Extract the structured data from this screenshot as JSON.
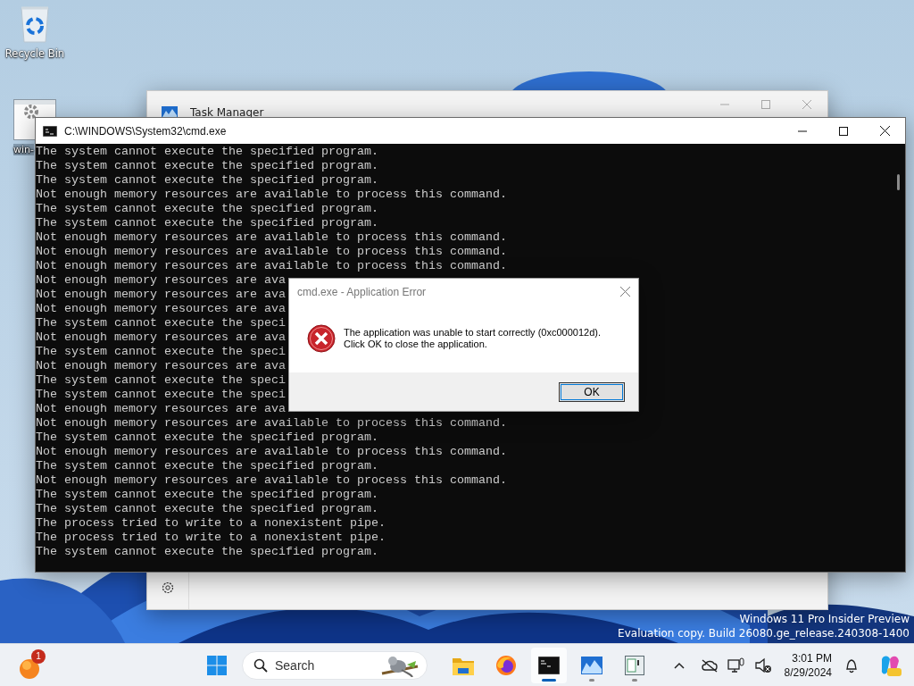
{
  "desktop_icons": [
    {
      "kind": "recycle",
      "label": "Recycle Bin"
    },
    {
      "kind": "settings",
      "label": "win-"
    }
  ],
  "task_manager": {
    "title": "Task Manager"
  },
  "console_window": {
    "title": "C:\\WINDOWS\\System32\\cmd.exe",
    "lines": [
      "The system cannot execute the specified program.",
      "The system cannot execute the specified program.",
      "The system cannot execute the specified program.",
      "Not enough memory resources are available to process this command.",
      "The system cannot execute the specified program.",
      "The system cannot execute the specified program.",
      "Not enough memory resources are available to process this command.",
      "Not enough memory resources are available to process this command.",
      "Not enough memory resources are available to process this command.",
      "Not enough memory resources are ava",
      "Not enough memory resources are ava",
      "Not enough memory resources are ava",
      "The system cannot execute the speci",
      "Not enough memory resources are ava",
      "The system cannot execute the speci",
      "Not enough memory resources are ava",
      "The system cannot execute the speci",
      "The system cannot execute the speci",
      "Not enough memory resources are ava",
      "Not enough memory resources are available to process this command.",
      "The system cannot execute the specified program.",
      "Not enough memory resources are available to process this command.",
      "The system cannot execute the specified program.",
      "Not enough memory resources are available to process this command.",
      "The system cannot execute the specified program.",
      "The system cannot execute the specified program.",
      "The process tried to write to a nonexistent pipe.",
      "The process tried to write to a nonexistent pipe.",
      "The system cannot execute the specified program."
    ]
  },
  "error_dialog": {
    "title": "cmd.exe - Application Error",
    "message_lines": [
      "The application was unable to start correctly (0xc000012d).",
      "Click OK to close the application."
    ],
    "button": "OK"
  },
  "watermark": [
    "Windows 11 Pro Insider Preview",
    "Evaluation copy. Build 26080.ge_release.240308-1400"
  ],
  "taskbar": {
    "widget_badge": "1",
    "search_label": "Search",
    "apps": [
      {
        "kind": "explorer",
        "selected": false,
        "running": false
      },
      {
        "kind": "firefox",
        "selected": false,
        "running": false
      },
      {
        "kind": "terminal",
        "selected": true,
        "running": true
      },
      {
        "kind": "monitor",
        "selected": false,
        "running": true
      },
      {
        "kind": "notepad",
        "selected": false,
        "running": true
      }
    ],
    "time": "3:01 PM",
    "date": "8/29/2024"
  }
}
